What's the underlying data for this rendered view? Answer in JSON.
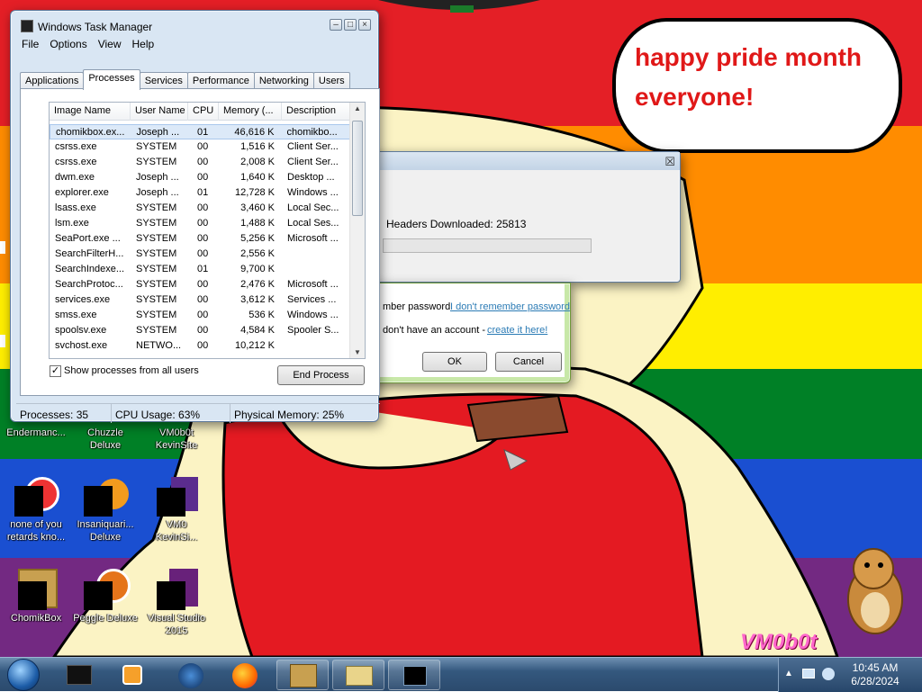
{
  "colors": {
    "stripes": [
      "#e41f26",
      "#ff8c00",
      "#ffee00",
      "#008026",
      "#1a4fd1",
      "#732982"
    ],
    "accent": "#1f6ea8"
  },
  "desktop": {
    "speech_bubble": [
      "happy pride month",
      "everyone!"
    ],
    "watermark": "VM0b0t",
    "icons": [
      {
        "label_lines": [
          "Endermanc..."
        ],
        "icon": "game-icon"
      },
      {
        "label_lines": [
          "Chuzzle",
          "Deluxe"
        ],
        "icon": "game-icon"
      },
      {
        "label_lines": [
          "VM0b0t",
          "KevinSite"
        ],
        "icon": "shortcut-icon"
      },
      {
        "label_lines": [
          "none of you",
          "retards kno..."
        ],
        "icon": "shortcut-icon"
      },
      {
        "label_lines": [
          "Insaniquari...",
          "Deluxe"
        ],
        "icon": "game-icon"
      },
      {
        "label_lines": [
          "VM0",
          "KevinSi..."
        ],
        "icon": "shortcut-icon"
      },
      {
        "label_lines": [
          "ChomikBox"
        ],
        "icon": "app-icon"
      },
      {
        "label_lines": [
          "Peggle Deluxe"
        ],
        "icon": "game-icon"
      },
      {
        "label_lines": [
          "Visual Studio",
          "2015"
        ],
        "icon": "app-icon"
      }
    ]
  },
  "progress_dialog": {
    "close_symbol": "☒",
    "status_text": "Headers Downloaded: 25813",
    "progress_fraction": 0
  },
  "login_dialog": {
    "remember_label": "mber password",
    "forgot_link": "I don't remember password",
    "no_account_text": "don't have an account -",
    "create_link": "create it here!",
    "ok_label": "OK",
    "cancel_label": "Cancel"
  },
  "task_manager": {
    "title": "Windows Task Manager",
    "menu": [
      "File",
      "Options",
      "View",
      "Help"
    ],
    "tabs": [
      "Applications",
      "Processes",
      "Services",
      "Performance",
      "Networking",
      "Users"
    ],
    "active_tab": "Processes",
    "columns": [
      "Image Name",
      "User Name",
      "CPU",
      "Memory (...",
      "Description"
    ],
    "rows": [
      [
        "chomikbox.ex...",
        "Joseph ...",
        "01",
        "46,616 K",
        "chomikbo..."
      ],
      [
        "csrss.exe",
        "SYSTEM",
        "00",
        "1,516 K",
        "Client Ser..."
      ],
      [
        "csrss.exe",
        "SYSTEM",
        "00",
        "2,008 K",
        "Client Ser..."
      ],
      [
        "dwm.exe",
        "Joseph ...",
        "00",
        "1,640 K",
        "Desktop ..."
      ],
      [
        "explorer.exe",
        "Joseph ...",
        "01",
        "12,728 K",
        "Windows ..."
      ],
      [
        "lsass.exe",
        "SYSTEM",
        "00",
        "3,460 K",
        "Local Sec..."
      ],
      [
        "lsm.exe",
        "SYSTEM",
        "00",
        "1,488 K",
        "Local Ses..."
      ],
      [
        "SeaPort.exe ...",
        "SYSTEM",
        "00",
        "5,256 K",
        "Microsoft ..."
      ],
      [
        "SearchFilterH...",
        "SYSTEM",
        "00",
        "2,556 K",
        ""
      ],
      [
        "SearchIndexe...",
        "SYSTEM",
        "01",
        "9,700 K",
        ""
      ],
      [
        "SearchProtoc...",
        "SYSTEM",
        "00",
        "2,476 K",
        "Microsoft ..."
      ],
      [
        "services.exe",
        "SYSTEM",
        "00",
        "3,612 K",
        "Services ..."
      ],
      [
        "smss.exe",
        "SYSTEM",
        "00",
        "536 K",
        "Windows ..."
      ],
      [
        "spoolsv.exe",
        "SYSTEM",
        "00",
        "4,584 K",
        "Spooler S..."
      ],
      [
        "svchost.exe",
        "NETWO...",
        "00",
        "10,212 K",
        ""
      ]
    ],
    "show_all_label": "Show processes from all users",
    "show_all_checked": true,
    "end_process_label": "End Process",
    "status": {
      "processes": "Processes: 35",
      "cpu": "CPU Usage: 63%",
      "memory": "Physical Memory: 25%"
    }
  },
  "taskbar": {
    "items": [
      "start-orb-icon",
      "media-center-icon",
      "media-player-icon",
      "globe-icon",
      "firefox-icon",
      "chomikbox-icon",
      "explorer-window-icon",
      "task-manager-icon"
    ],
    "time": "10:45 AM",
    "date": "6/28/2024"
  }
}
